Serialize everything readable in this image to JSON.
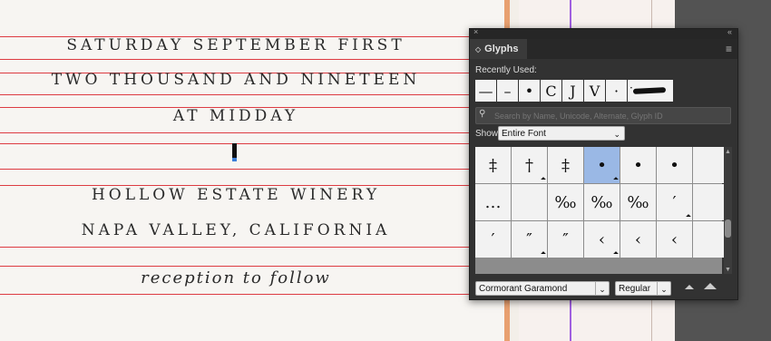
{
  "document": {
    "lines": [
      "SATURDAY SEPTEMBER FIRST",
      "TWO THOUSAND AND NINETEEN",
      "AT MIDDAY",
      "HOLLOW ESTATE WINERY",
      "NAPA VALLEY, CALIFORNIA",
      "reception to follow"
    ]
  },
  "panel": {
    "close_glyph": "×",
    "collapse_glyph": "«",
    "tab_label": "Glyphs",
    "menu_glyph": "≡",
    "recently_used_label": "Recently Used:",
    "recent_glyphs": [
      "—",
      "–",
      "•",
      "C",
      "J",
      "V",
      "·",
      "·"
    ],
    "search_icon": "⚲",
    "search_placeholder": "Search by Name, Unicode, Alternate, Glyph ID",
    "show_label": "Show:",
    "show_value": "Entire Font",
    "grid_glyphs": [
      "‡",
      "†",
      "‡",
      "•",
      "•",
      "•",
      "",
      "…",
      "",
      "‰",
      "‰",
      "‰",
      "′",
      "",
      "′",
      "″",
      "″",
      "‹",
      "‹",
      "‹",
      ""
    ],
    "font_family": "Cormorant Garamond",
    "font_style": "Regular",
    "colors": {
      "panel_bg": "#323232",
      "selected_cell": "#9ab8e5",
      "guide": "#d9272f"
    },
    "icons": {
      "close": "close-icon",
      "collapse": "double-chevron-icon",
      "menu": "panel-menu-icon",
      "search": "search-icon",
      "zoom_out": "small-mountain-icon",
      "zoom_in": "large-mountain-icon"
    }
  }
}
